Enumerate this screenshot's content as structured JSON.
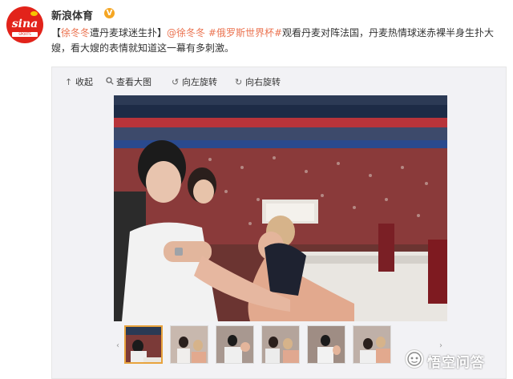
{
  "account": {
    "name": "新浪体育",
    "verified_badge": "V",
    "logo_text": "sina",
    "logo_subtext": "SPORTS"
  },
  "post": {
    "title_open": "【",
    "title_link": "徐冬冬",
    "title_rest": "遭丹麦球迷生扑】",
    "mention": "@徐冬冬",
    "hashtag": "#俄罗斯世界杯#",
    "body": "观看丹麦对阵法国，丹麦热情球迷赤裸半身生扑大嫂，看大嫂的表情就知道这一幕有多刺激。"
  },
  "toolbar": {
    "collapse": "收起",
    "view_large": "查看大图",
    "rotate_left": "向左旋转",
    "rotate_right": "向右旋转"
  },
  "icons": {
    "collapse": "arrow-up-icon",
    "view_large": "magnifier-icon",
    "rotate_left": "rotate-left-icon",
    "rotate_right": "rotate-right-icon"
  },
  "thumbnails": {
    "count": 6,
    "active_index": 0
  },
  "watermark": {
    "text": "悟空问答"
  },
  "colors": {
    "accent": "#eb7350",
    "brand_red": "#e2231a",
    "verified": "#f5a623",
    "thumb_active": "#e8a33d"
  }
}
